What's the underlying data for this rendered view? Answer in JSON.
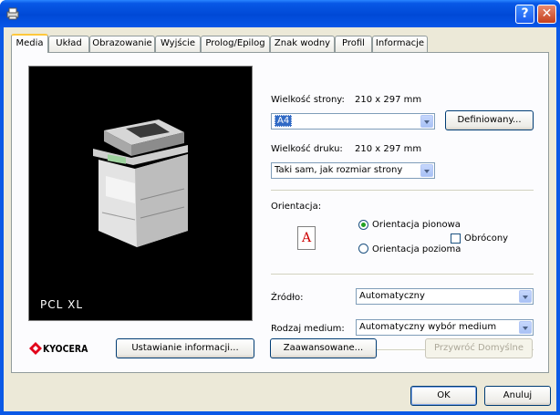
{
  "window": {
    "help_label": "?",
    "close_label": "✕"
  },
  "tabs": [
    {
      "label": "Media",
      "active": true
    },
    {
      "label": "Układ"
    },
    {
      "label": "Obrazowanie"
    },
    {
      "label": "Wyjście"
    },
    {
      "label": "Prolog/Epilog"
    },
    {
      "label": "Znak wodny"
    },
    {
      "label": "Profil"
    },
    {
      "label": "Informacje"
    }
  ],
  "preview": {
    "label": "PCL XL"
  },
  "page_size": {
    "label": "Wielkość strony:",
    "dimensions": "210 x 297 mm",
    "value": "A4",
    "custom_button": "Definiowany..."
  },
  "print_size": {
    "label": "Wielkość druku:",
    "dimensions": "210 x 297 mm",
    "value": "Taki sam, jak rozmiar strony"
  },
  "orientation": {
    "label": "Orientacja:",
    "icon_letter": "A",
    "portrait": "Orientacja pionowa",
    "landscape": "Orientacja pozioma",
    "rotated": "Obrócony"
  },
  "source": {
    "label": "Źródło:",
    "value": "Automatyczny"
  },
  "media_type": {
    "label": "Rodzaj medium:",
    "value": "Automatyczny wybór medium"
  },
  "buttons": {
    "settings_info": "Ustawianie informacji...",
    "advanced": "Zaawansowane...",
    "restore_defaults": "Przywróć Domyślne",
    "ok": "OK",
    "cancel": "Anuluj"
  },
  "logo": {
    "text": "KYOCERA"
  }
}
